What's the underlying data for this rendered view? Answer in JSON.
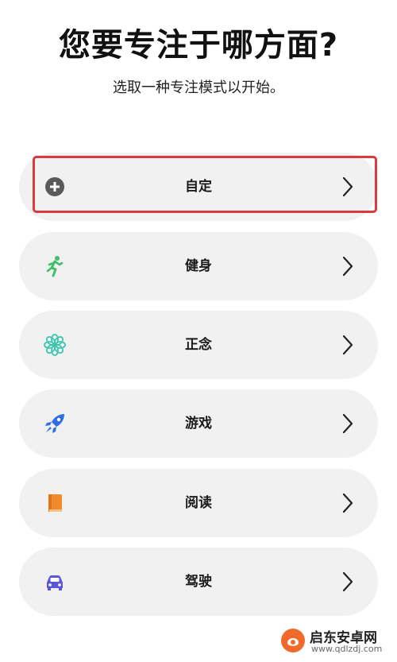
{
  "header": {
    "title": "您要专注于哪方面?",
    "subtitle": "选取一种专注模式以开始。"
  },
  "focus_modes": [
    {
      "label": "自定",
      "icon": "plus-circle-icon",
      "icon_color": "#5a5a5a",
      "highlighted": true
    },
    {
      "label": "健身",
      "icon": "running-figure-icon",
      "icon_color": "#3fbf6a",
      "highlighted": false
    },
    {
      "label": "正念",
      "icon": "flower-icon",
      "icon_color": "#3cc5b0",
      "highlighted": false
    },
    {
      "label": "游戏",
      "icon": "rocket-icon",
      "icon_color": "#2f6fe0",
      "highlighted": false
    },
    {
      "label": "阅读",
      "icon": "book-icon",
      "icon_color": "#f08a2a",
      "highlighted": false
    },
    {
      "label": "驾驶",
      "icon": "car-icon",
      "icon_color": "#5a58d6",
      "highlighted": false
    }
  ],
  "colors": {
    "row_background": "#f1f1f1",
    "highlight_border": "#d93a3a",
    "chevron": "#222222"
  },
  "watermark": {
    "name": "启东安卓网",
    "url": "www.qdlzdj.com"
  }
}
